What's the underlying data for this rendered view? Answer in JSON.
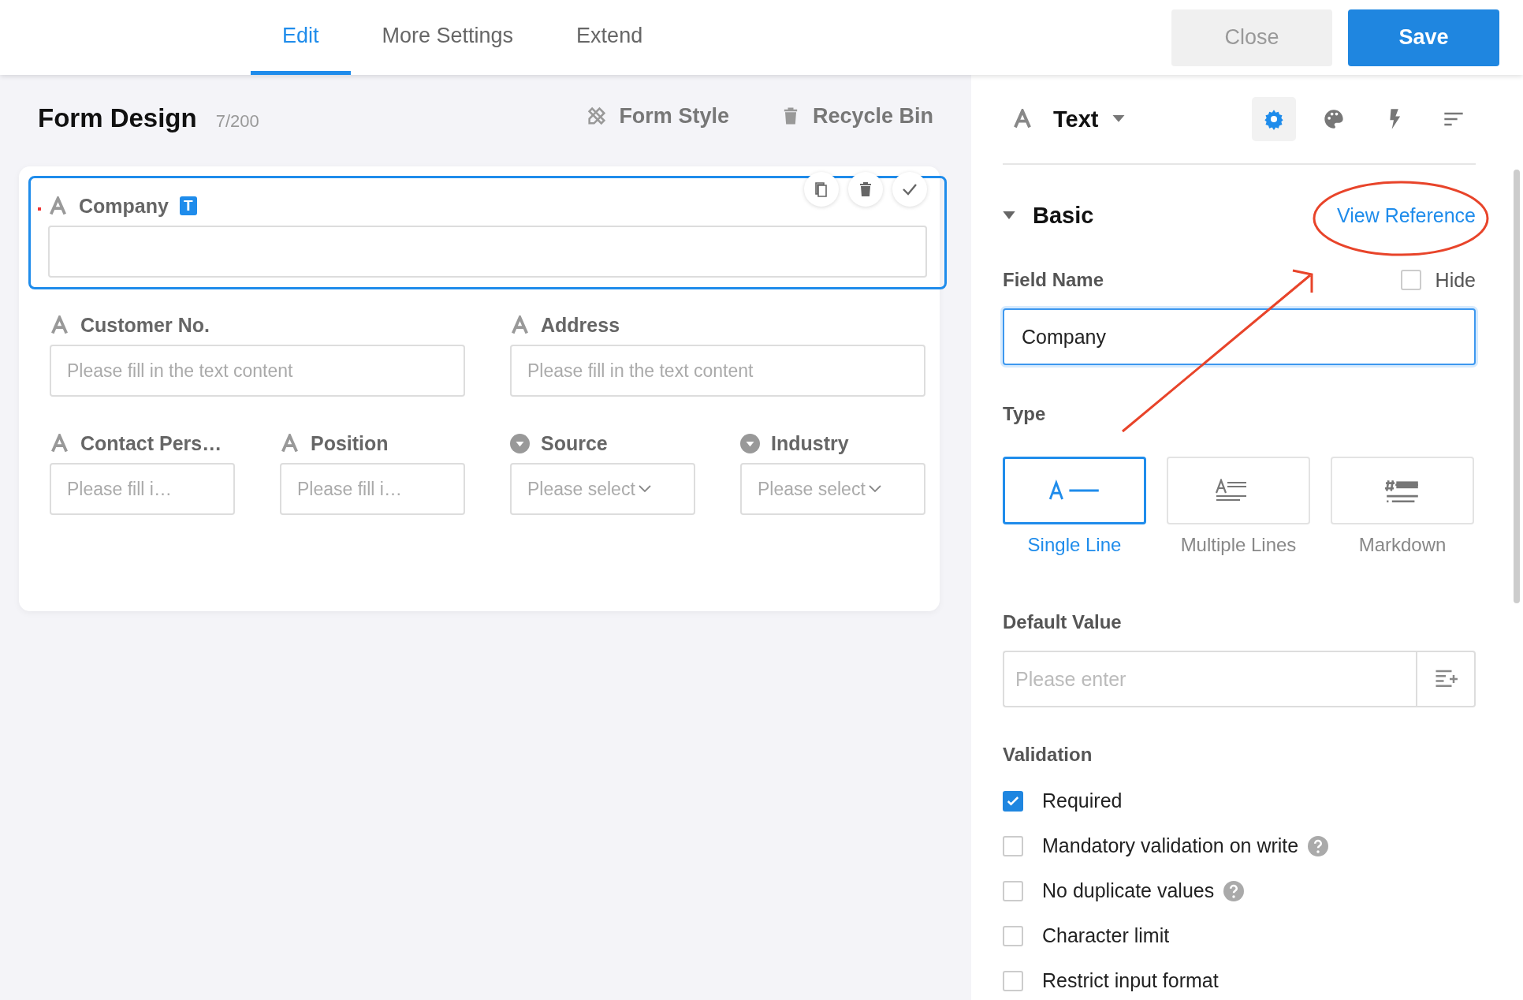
{
  "tabs": [
    {
      "label": "Edit",
      "selected": true
    },
    {
      "label": "More Settings",
      "selected": false
    },
    {
      "label": "Extend",
      "selected": false
    }
  ],
  "buttons": [
    {
      "kind": "secondary",
      "label": "Close"
    },
    {
      "kind": "primary",
      "label": "Save"
    }
  ],
  "form": {
    "title": "Form Design",
    "count": "7/200",
    "actions": [
      {
        "kind": "style",
        "label": "Form Style"
      },
      {
        "kind": "bin",
        "label": "Recycle Bin"
      }
    ],
    "fields": [
      {
        "kind": "text",
        "label": "Company",
        "badge": "T",
        "required": true,
        "selected": true
      },
      {
        "kind": "text",
        "label": "Customer No.",
        "placeholder": "Please fill in the text content",
        "required": false,
        "selected": false
      },
      {
        "kind": "text",
        "label": "Address",
        "placeholder": "Please fill in the text content",
        "required": false,
        "selected": false
      },
      {
        "kind": "text",
        "label": "Contact Pers…",
        "placeholder": "Please fill i…",
        "required": false,
        "selected": false
      },
      {
        "kind": "text",
        "label": "Position",
        "placeholder": "Please fill i…",
        "required": false,
        "selected": false
      },
      {
        "kind": "select",
        "label": "Source",
        "placeholder": "Please select",
        "required": false,
        "selected": false
      },
      {
        "kind": "select",
        "label": "Industry",
        "placeholder": "Please select",
        "required": false,
        "selected": false
      }
    ]
  },
  "panel": {
    "component": "Text",
    "tools": [
      {
        "kind": "settings",
        "selected": true
      },
      {
        "kind": "palette",
        "selected": false
      },
      {
        "kind": "bolt",
        "selected": false
      },
      {
        "kind": "sort",
        "selected": false
      }
    ],
    "section": {
      "title": "Basic",
      "expanded": true,
      "link": "View Reference"
    },
    "field_name": {
      "label": "Field Name",
      "value": "Company",
      "hide_label": "Hide",
      "hidden": false
    },
    "type": {
      "label": "Type",
      "options": [
        {
          "kind": "single",
          "label": "Single Line",
          "selected": true
        },
        {
          "kind": "multi",
          "label": "Multiple Lines",
          "selected": false
        },
        {
          "kind": "markdown",
          "label": "Markdown",
          "selected": false
        }
      ]
    },
    "default_value": {
      "label": "Default Value",
      "placeholder": "Please enter"
    },
    "validation": {
      "label": "Validation",
      "options": [
        {
          "label": "Required",
          "checked": true,
          "help": false
        },
        {
          "label": "Mandatory validation on write",
          "checked": false,
          "help": true
        },
        {
          "label": "No duplicate values",
          "checked": false,
          "help": true
        },
        {
          "label": "Character limit",
          "checked": false,
          "help": false
        },
        {
          "label": "Restrict input format",
          "checked": false,
          "help": false
        }
      ]
    }
  }
}
